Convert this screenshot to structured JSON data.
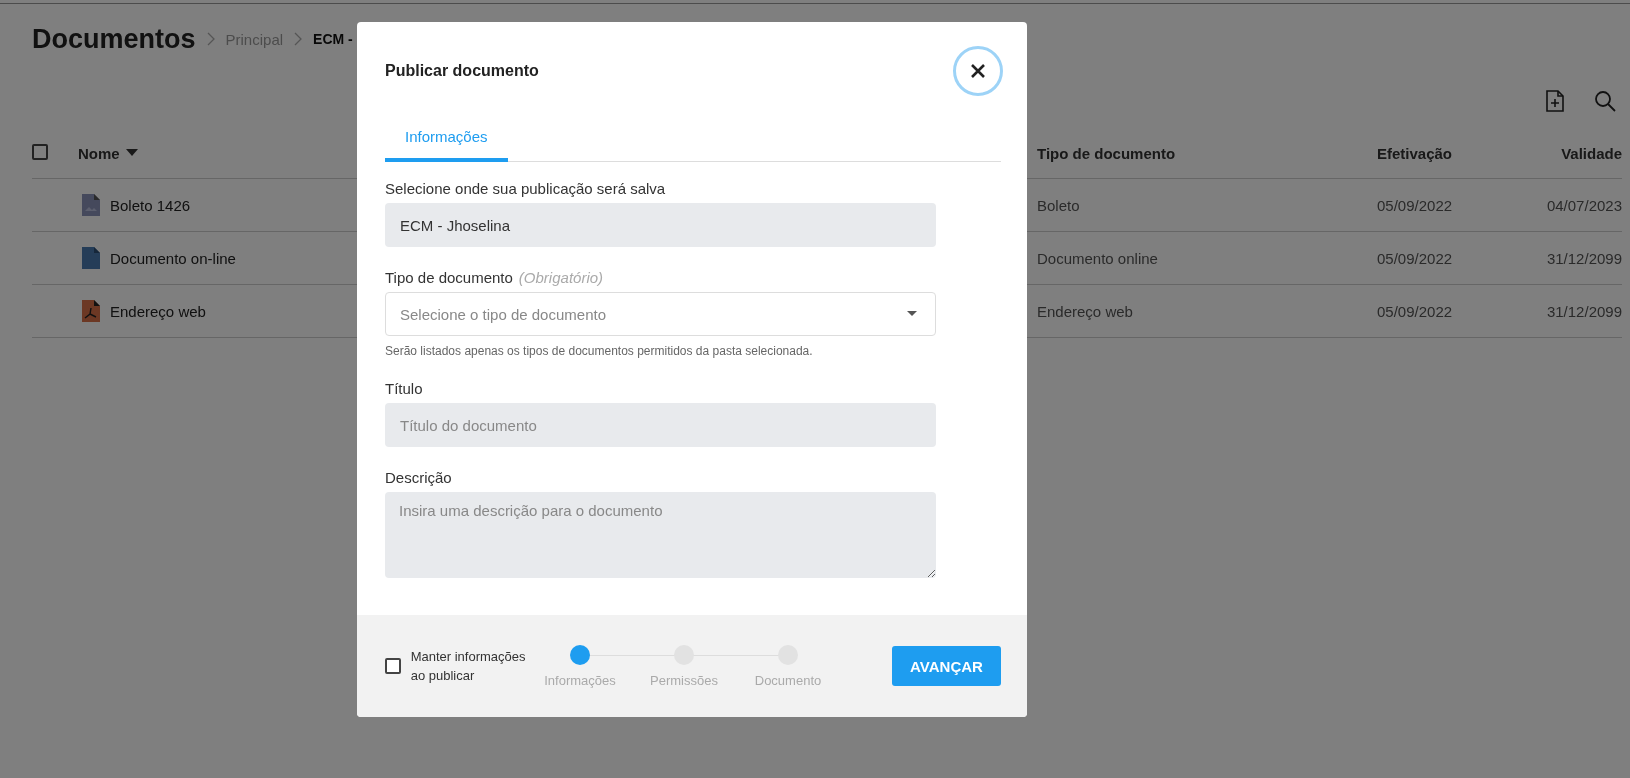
{
  "page": {
    "title": "Documentos",
    "breadcrumb": [
      {
        "label": "Principal",
        "current": false
      },
      {
        "label": "ECM -",
        "current": true
      }
    ]
  },
  "table": {
    "select_all": {
      "checked": false
    },
    "columns": [
      {
        "label": "Nome",
        "sorted": true
      },
      {
        "label": "Tipo de documento",
        "sorted": false
      },
      {
        "label": "Efetivação",
        "sorted": false
      },
      {
        "label": "Validade",
        "sorted": false
      }
    ],
    "rows": [
      {
        "kind": "image",
        "name": "Boleto 1426",
        "type": "Boleto",
        "effective": "05/09/2022",
        "valid": "04/07/2023"
      },
      {
        "kind": "document",
        "name": "Documento on-line",
        "type": "Documento online",
        "effective": "05/09/2022",
        "valid": "31/12/2099"
      },
      {
        "kind": "pdf",
        "name": "Endereço web",
        "type": "Endereço web",
        "effective": "05/09/2022",
        "valid": "31/12/2099"
      }
    ]
  },
  "modal": {
    "title": "Publicar documento",
    "tabs": [
      {
        "label": "Informações",
        "selected": true
      }
    ],
    "fields": [
      {
        "kind": "readonly",
        "label": "Selecione onde sua publicação será salva",
        "value": "ECM - Jhoselina"
      },
      {
        "kind": "select",
        "label": "Tipo de documento",
        "note": "(Obrigatório)",
        "placeholder": "Selecione o tipo de documento",
        "hint": "Serão listados apenas os tipos de documentos permitidos da pasta selecionada."
      },
      {
        "kind": "text",
        "label": "Título",
        "placeholder": "Título do documento"
      },
      {
        "kind": "textarea",
        "label": "Descrição",
        "placeholder": "Insira uma descrição para o documento"
      }
    ],
    "keep": {
      "label": "Manter informações ao publicar",
      "checked": false
    },
    "steps": [
      {
        "label": "Informações",
        "selected": true
      },
      {
        "label": "Permissões",
        "selected": false
      },
      {
        "label": "Documento",
        "selected": false
      }
    ],
    "next_button": "AVANÇAR"
  }
}
